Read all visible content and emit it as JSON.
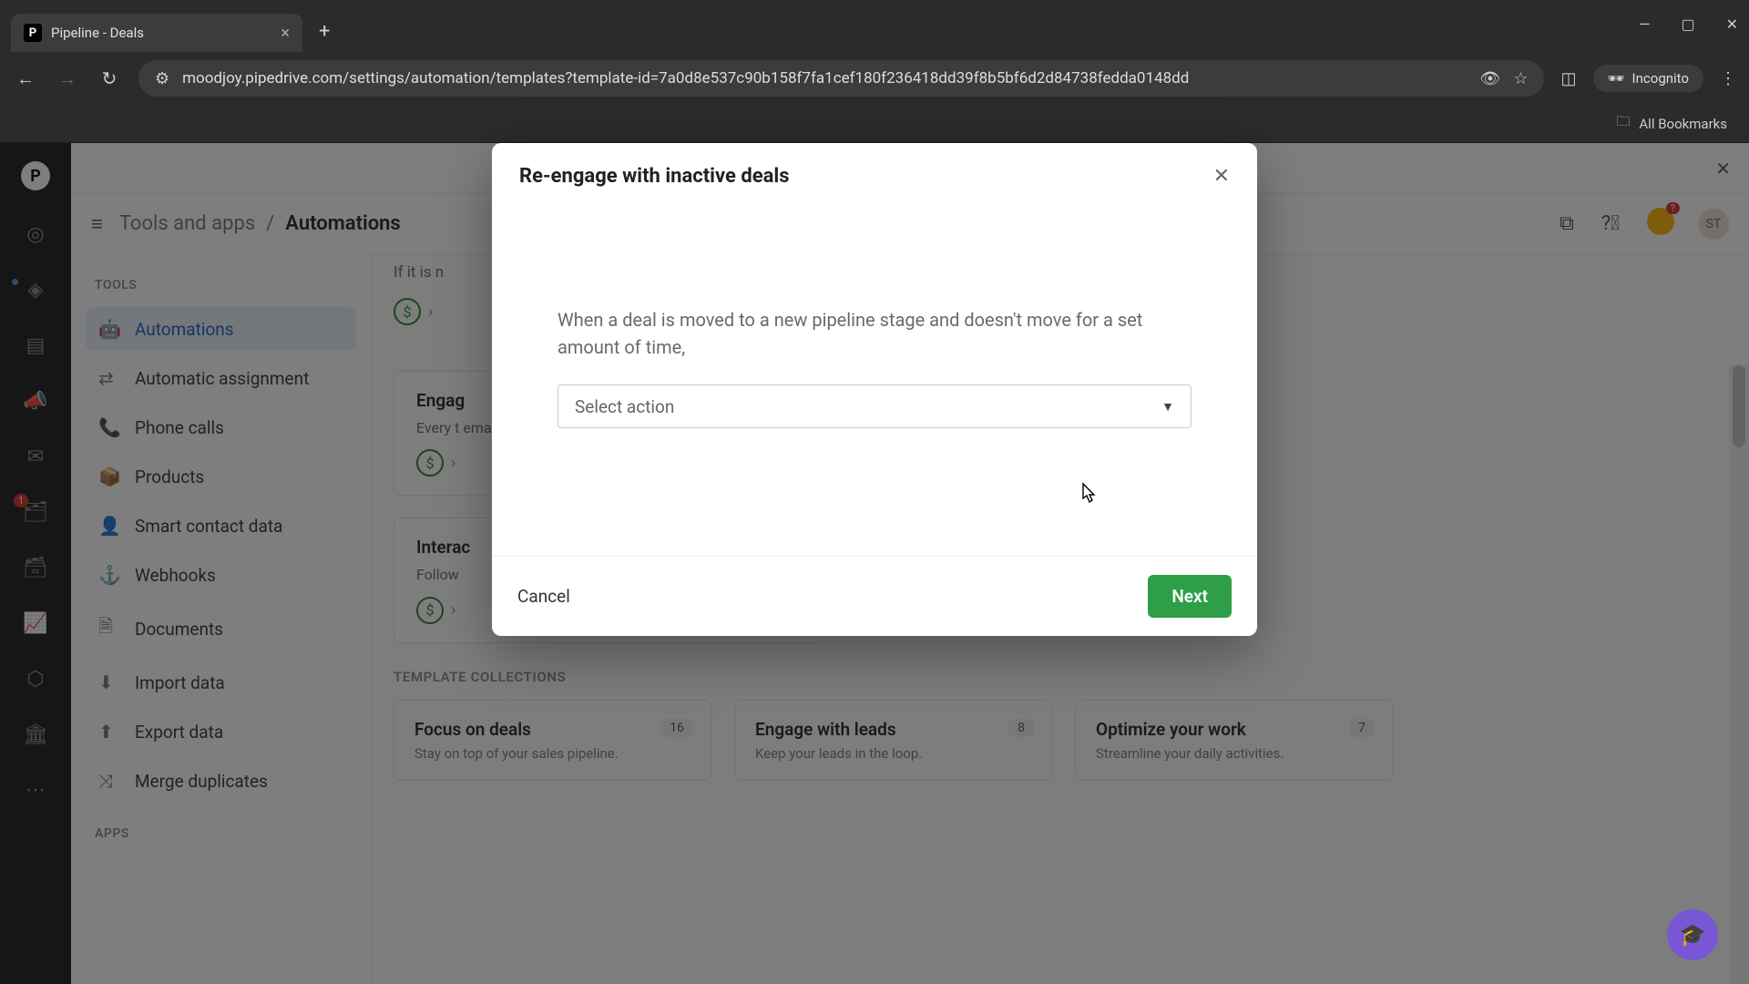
{
  "browser": {
    "tab_title": "Pipeline - Deals",
    "tab_favicon_letter": "P",
    "url": "moodjoy.pipedrive.com/settings/automation/templates?template-id=7a0d8e537c90b158f7fa1cef180f236418dd39f8b5bf6d2d84738fedda0148dd",
    "incognito_label": "Incognito",
    "all_bookmarks": "All Bookmarks"
  },
  "rail": {
    "logo_letter": "P",
    "mail_badge": "1"
  },
  "breadcrumb": {
    "parent": "Tools and apps",
    "current": "Automations",
    "avatar": "ST"
  },
  "sidebar": {
    "tools_label": "TOOLS",
    "items": [
      {
        "label": "Automations"
      },
      {
        "label": "Automatic assignment"
      },
      {
        "label": "Phone calls"
      },
      {
        "label": "Products"
      },
      {
        "label": "Smart contact data"
      },
      {
        "label": "Webhooks"
      },
      {
        "label": "Documents"
      },
      {
        "label": "Import data"
      },
      {
        "label": "Export data"
      },
      {
        "label": "Merge duplicates"
      }
    ],
    "apps_label": "APPS"
  },
  "cards": {
    "partial_top": "If it is n",
    "engage_title": "Engag",
    "engage_sub": "Every t\nemail s",
    "interact_title": "Interac",
    "interact_sub": "Follow"
  },
  "templates": {
    "section_label": "TEMPLATE COLLECTIONS",
    "cards": [
      {
        "title": "Focus on deals",
        "sub": "Stay on top of your sales pipeline.",
        "count": "16"
      },
      {
        "title": "Engage with leads",
        "sub": "Keep your leads in the loop.",
        "count": "8"
      },
      {
        "title": "Optimize your work",
        "sub": "Streamline your daily activities.",
        "count": "7"
      }
    ]
  },
  "modal": {
    "title": "Re-engage with inactive deals",
    "prompt": "When a deal is moved to a new pipeline stage and doesn't move for a set amount of time,",
    "select_placeholder": "Select action",
    "cancel": "Cancel",
    "next": "Next"
  },
  "lightbulb_badge": "?"
}
